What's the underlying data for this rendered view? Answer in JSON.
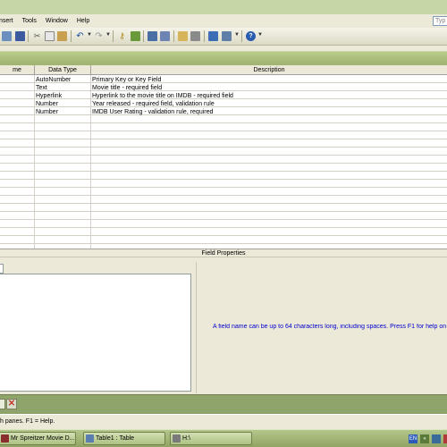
{
  "menubar": {
    "items": [
      "nsert",
      "Tools",
      "Window",
      "Help"
    ]
  },
  "help_box": {
    "text": "Typ"
  },
  "toolbar": {
    "icons": [
      "view-icon",
      "save-icon",
      "print-icon",
      "cut-icon",
      "copy-icon",
      "paste-icon",
      "undo-icon",
      "redo-icon",
      "primary-key-icon",
      "indexes-icon",
      "insert-rows-icon",
      "delete-rows-icon",
      "properties-icon",
      "build-icon",
      "database-window-icon",
      "new-object-icon",
      "help-icon"
    ]
  },
  "grid": {
    "columns": {
      "name": "me",
      "type": "Data Type",
      "desc": "Description"
    },
    "rows": [
      {
        "type": "AutoNumber",
        "desc": "Primary Key or Key Field"
      },
      {
        "type": "Text",
        "desc": "Movie title - required field"
      },
      {
        "type": "Hyperlink",
        "desc": "Hyperlink to the movie title on IMDB - required field"
      },
      {
        "type": "Number",
        "desc": "Year released - required field, validation rule"
      },
      {
        "type": "Number",
        "desc": "IMDB User Rating  - validation rule, required"
      }
    ]
  },
  "field_properties": {
    "title": "Field Properties",
    "hint": "A field name can be up to 64 characters long, including spaces.  Press F1 for help on"
  },
  "status": {
    "text": "h panes.  F1 = Help."
  },
  "taskbar": {
    "tasks": [
      "Mr Spreitzer Movie D...",
      "Table1 : Table",
      "H:\\"
    ],
    "tray": [
      "EN",
      "«"
    ]
  },
  "colors": {
    "accent": "#9fb26e",
    "hint": "#0000cc"
  }
}
